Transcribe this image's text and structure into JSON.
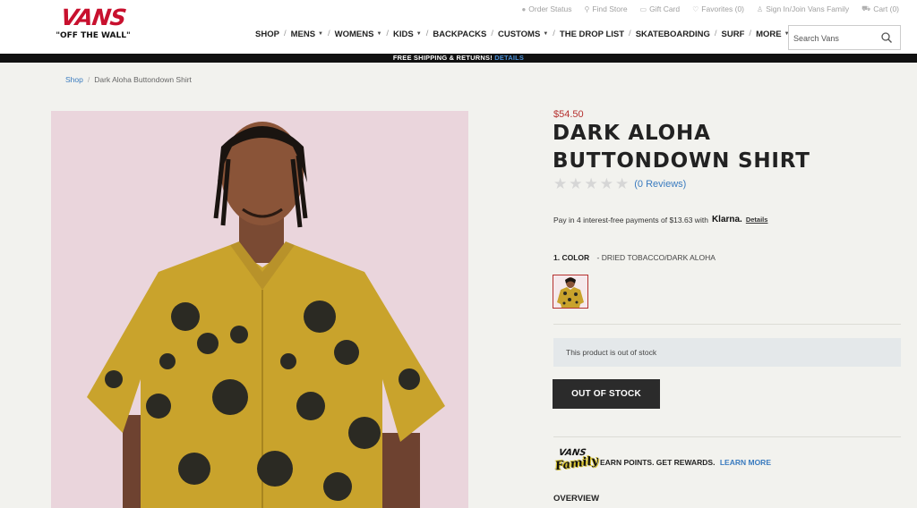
{
  "brand": {
    "name": "VANS",
    "tagline": "\"OFF THE WALL\""
  },
  "utility_nav": [
    {
      "label": "Order Status",
      "icon": "info-circle-icon"
    },
    {
      "label": "Find Store",
      "icon": "map-pin-icon"
    },
    {
      "label": "Gift Card",
      "icon": "gift-icon"
    },
    {
      "label": "Favorites (0)",
      "icon": "heart-icon"
    },
    {
      "label": "Sign In/Join Vans Family",
      "icon": "user-icon"
    },
    {
      "label": "Cart (0)",
      "icon": "cart-icon"
    }
  ],
  "main_nav": [
    {
      "label": "SHOP",
      "has_menu": false
    },
    {
      "label": "MENS",
      "has_menu": true
    },
    {
      "label": "WOMENS",
      "has_menu": true
    },
    {
      "label": "KIDS",
      "has_menu": true
    },
    {
      "label": "BACKPACKS",
      "has_menu": false
    },
    {
      "label": "CUSTOMS",
      "has_menu": true
    },
    {
      "label": "THE DROP LIST",
      "has_menu": false
    },
    {
      "label": "SKATEBOARDING",
      "has_menu": false
    },
    {
      "label": "SURF",
      "has_menu": false
    },
    {
      "label": "MORE",
      "has_menu": true
    }
  ],
  "search": {
    "placeholder": "Search Vans",
    "icon": "search-icon"
  },
  "promo": {
    "text": "FREE SHIPPING & RETURNS!",
    "link": "DETAILS"
  },
  "breadcrumb": {
    "root": "Shop",
    "separator": "/",
    "current": "Dark Aloha Buttondown Shirt"
  },
  "product": {
    "price": "$54.50",
    "title": "DARK ALOHA BUTTONDOWN SHIRT",
    "rating": 0,
    "reviews_label": "(0 Reviews)",
    "klarna_text": "Pay in 4 interest-free payments of $13.63 with",
    "klarna_brand": "Klarna.",
    "klarna_link": "Details",
    "color_number": "1. COLOR",
    "color_value": "- DRIED TOBACCO/DARK ALOHA",
    "stock_message": "This product is out of stock",
    "button_label": "OUT OF STOCK",
    "family_logo_top": "VANS",
    "family_logo_bottom": "Family",
    "family_text": "EARN POINTS. GET REWARDS.",
    "family_link": "LEARN MORE",
    "overview_label": "OVERVIEW"
  },
  "colors": {
    "brand_red": "#c8102e",
    "price_red": "#b5312f",
    "link_blue": "#3a7bbf",
    "shirt_mustard": "#c9a32c",
    "image_bg": "#ead5dc"
  }
}
